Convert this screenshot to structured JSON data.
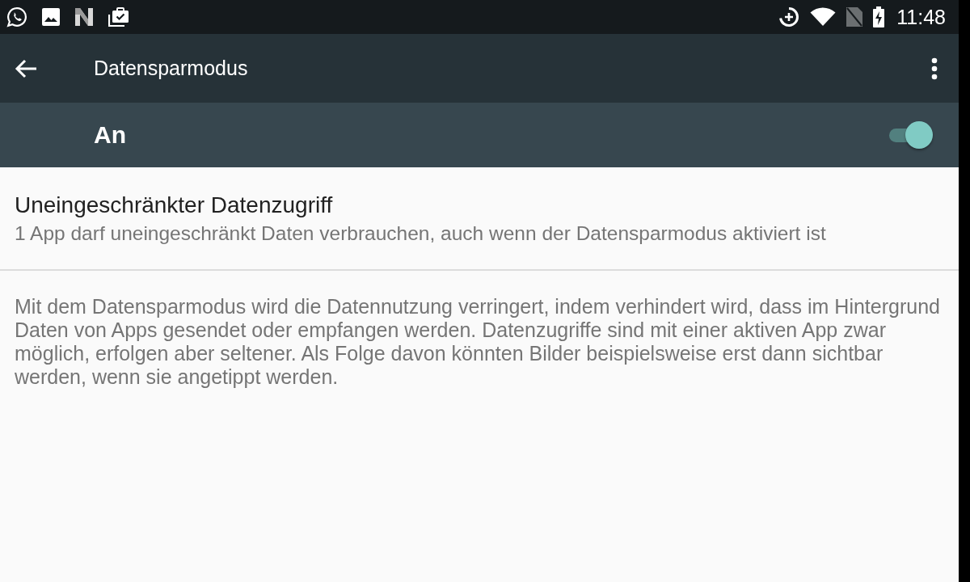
{
  "status_bar": {
    "time": "11:48"
  },
  "toolbar": {
    "title": "Datensparmodus"
  },
  "master_switch": {
    "label": "An",
    "on": true
  },
  "settings": [
    {
      "title": "Uneingeschränkter Datenzugriff",
      "summary": "1 App darf uneingeschränkt Daten verbrauchen, auch wenn der Datensparmodus aktiviert ist"
    }
  ],
  "description": "Mit dem Datensparmodus wird die Datennutzung verringert, indem verhindert wird, dass im Hintergrund Daten von Apps gesendet oder empfangen werden. Datenzugriffe sind mit einer aktiven App zwar möglich, erfolgen aber seltener. Als Folge davon könnten Bilder beispielsweise erst dann sichtbar werden, wenn sie angetippt werden."
}
